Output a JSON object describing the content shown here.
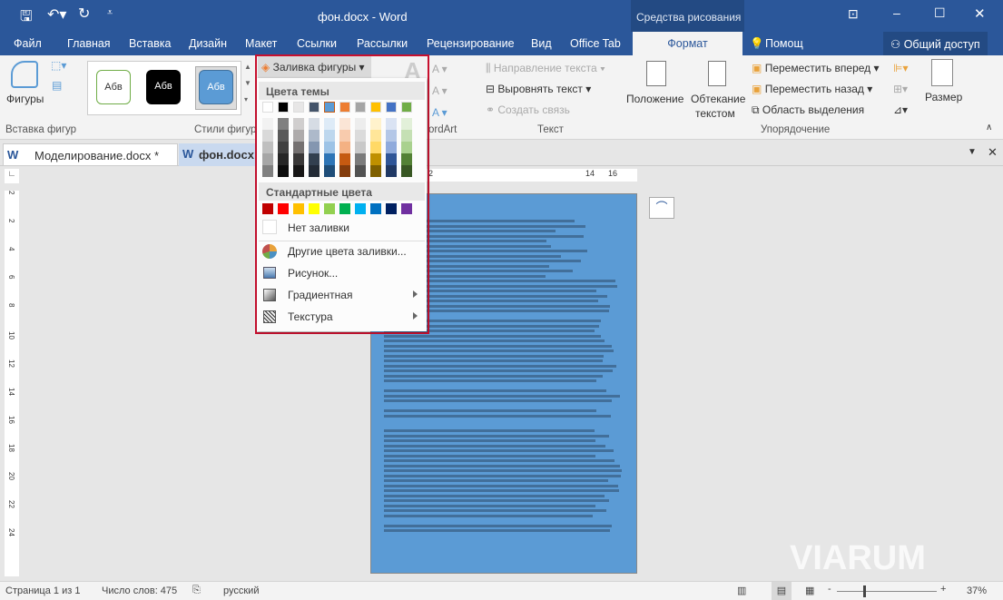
{
  "title": "фон.docx - Word",
  "context_title": "Средства рисования",
  "tabs": [
    "Файл",
    "Главная",
    "Вставка",
    "Дизайн",
    "Макет",
    "Ссылки",
    "Рассылки",
    "Рецензирование",
    "Вид",
    "Office Tab"
  ],
  "active_tab": "Формат",
  "help": "Помощ",
  "share": "Общий доступ",
  "ribbon": {
    "shapes": "Фигуры",
    "insert_group": "Вставка фигур",
    "style_sample": "Абв",
    "styles_group": "Стили фигур",
    "fill_button": "Заливка фигуры",
    "wordart_group": "ordArt",
    "text_direction": "Направление текста",
    "align_text": "Выровнять текст",
    "create_link": "Создать связь",
    "text_group": "Текст",
    "position": "Положение",
    "wrap1": "Обтекание",
    "wrap2": "текстом",
    "bring_forward": "Переместить вперед",
    "send_backward": "Переместить назад",
    "selection_pane": "Область выделения",
    "arrange_group": "Упорядочение",
    "size": "Размер"
  },
  "doc_tabs": [
    "Моделирование.docx *",
    "фон.docx"
  ],
  "menu": {
    "theme_header": "Цвета темы",
    "theme_colors": [
      "#ffffff",
      "#000000",
      "#e7e6e6",
      "#44546a",
      "#5b9bd5",
      "#ed7d31",
      "#a5a5a5",
      "#ffc000",
      "#4472c4",
      "#70ad47"
    ],
    "theme_shades": [
      [
        "#f2f2f2",
        "#d9d9d9",
        "#bfbfbf",
        "#a6a6a6",
        "#808080"
      ],
      [
        "#808080",
        "#595959",
        "#404040",
        "#262626",
        "#0d0d0d"
      ],
      [
        "#d0cece",
        "#aeabab",
        "#757171",
        "#3a3838",
        "#171616"
      ],
      [
        "#d6dce4",
        "#adb9ca",
        "#8496b0",
        "#323f4f",
        "#222a35"
      ],
      [
        "#deebf7",
        "#bdd7ee",
        "#9dc3e6",
        "#2e75b6",
        "#1f4e79"
      ],
      [
        "#fbe5d6",
        "#f8cbad",
        "#f4b183",
        "#c55a11",
        "#843c0c"
      ],
      [
        "#ededed",
        "#dbdbdb",
        "#c9c9c9",
        "#7b7b7b",
        "#525252"
      ],
      [
        "#fff2cc",
        "#ffe699",
        "#ffd966",
        "#bf9000",
        "#7f6000"
      ],
      [
        "#dae3f3",
        "#b4c7e7",
        "#8faadc",
        "#2f5597",
        "#203864"
      ],
      [
        "#e2f0d9",
        "#c5e0b4",
        "#a9d18e",
        "#538135",
        "#385723"
      ]
    ],
    "selected_color": "#5b9bd5",
    "standard_header": "Стандартные цвета",
    "standard_colors": [
      "#c00000",
      "#ff0000",
      "#ffc000",
      "#ffff00",
      "#92d050",
      "#00b050",
      "#00b0f0",
      "#0070c0",
      "#002060",
      "#7030a0"
    ],
    "no_fill": "Нет заливки",
    "more_colors": "Другие цвета заливки...",
    "picture": "Рисунок...",
    "gradient": "Градиентная",
    "texture": "Текстура"
  },
  "ruler_numbers": [
    "2",
    "14",
    "16"
  ],
  "vruler": [
    "2",
    "2",
    "4",
    "6",
    "8",
    "10",
    "12",
    "14",
    "16",
    "18",
    "20",
    "22",
    "24"
  ],
  "page_color": "#5b9bd5",
  "status": {
    "page": "Страница 1 из 1",
    "words": "Число слов: 475",
    "lang": "русский",
    "zoom": "37%"
  },
  "watermark": "VIARUM"
}
